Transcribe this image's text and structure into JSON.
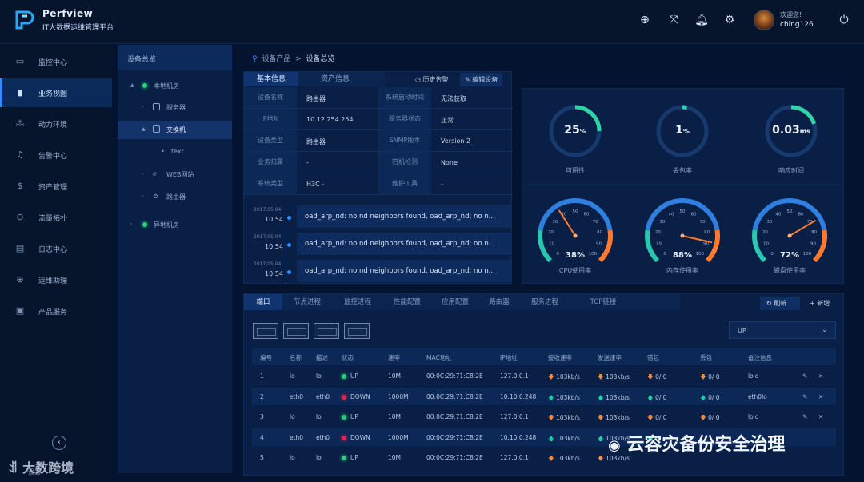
{
  "header": {
    "brand": "Perfview",
    "subtitle": "IT大数据运维管理平台",
    "welcome": "欢迎您!",
    "username": "ching126",
    "icons": [
      "add-circle-icon",
      "fullscreen-icon",
      "bell-icon",
      "settings-icon",
      "power-icon"
    ]
  },
  "sidebar": {
    "items": [
      {
        "label": "监控中心",
        "icon": "monitor-icon"
      },
      {
        "label": "业务视图",
        "icon": "bar-chart-icon",
        "active": true
      },
      {
        "label": "动力环境",
        "icon": "network-icon"
      },
      {
        "label": "告警中心",
        "icon": "bell-icon"
      },
      {
        "label": "资产管理",
        "icon": "dollar-icon"
      },
      {
        "label": "流量拓扑",
        "icon": "topology-icon"
      },
      {
        "label": "日志中心",
        "icon": "document-icon"
      },
      {
        "label": "运维助理",
        "icon": "plus-circle-icon"
      },
      {
        "label": "产品服务",
        "icon": "box-icon"
      }
    ],
    "settings": "设置"
  },
  "tree": {
    "title": "设备总览",
    "nodes": [
      {
        "label": "本地机房"
      },
      {
        "label": "服务器"
      },
      {
        "label": "交换机"
      },
      {
        "label": "text"
      },
      {
        "label": "WEB网站"
      },
      {
        "label": "路由器"
      },
      {
        "label": "异地机房"
      }
    ]
  },
  "breadcrumb": {
    "part1": "设备产品",
    "sep": ">",
    "part2": "设备总览"
  },
  "info": {
    "tab_basic": "基本信息",
    "tab_asset": "资产信息",
    "btn_history": "历史告警",
    "btn_edit": "编辑设备",
    "rows": [
      {
        "k1": "设备名称",
        "v1": "路由器",
        "k2": "系统启动时间",
        "v2": "无法获取"
      },
      {
        "k1": "IP地址",
        "v1": "10.12.254.254",
        "k2": "服务器状态",
        "v2": "正常"
      },
      {
        "k1": "设备类型",
        "v1": "路由器",
        "k2": "SNMP版本",
        "v2": "Version 2"
      },
      {
        "k1": "业务归属",
        "v1": "-",
        "k2": "宕机检测",
        "v2": "None"
      },
      {
        "k1": "系统类型",
        "v1": "H3C -",
        "k2": "维护工具",
        "v2": "-"
      }
    ],
    "logs": [
      {
        "date": "2017.05.04",
        "time": "10:54",
        "msg": "oad_arp_nd: no nd neighbors found, oad_arp_nd: no n..."
      },
      {
        "date": "2017.05.04",
        "time": "10:54",
        "msg": "oad_arp_nd: no nd neighbors found, oad_arp_nd: no n..."
      },
      {
        "date": "2017.05.04",
        "time": "10:54",
        "msg": "oad_arp_nd: no nd neighbors found, oad_arp_nd: no n..."
      }
    ]
  },
  "metrics": {
    "rings": [
      {
        "value": "25",
        "unit": "%",
        "label": "可用性",
        "fraction": 0.25
      },
      {
        "value": "1",
        "unit": "%",
        "label": "丢包率",
        "fraction": 0.03
      },
      {
        "value": "0.03",
        "unit": "ms",
        "label": "响应时间",
        "fraction": 0.2
      }
    ],
    "gauges": [
      {
        "value": "38%",
        "label": "CPU使用率",
        "fraction": 0.38
      },
      {
        "value": "88%",
        "label": "内存使用率",
        "fraction": 0.88
      },
      {
        "value": "72%",
        "label": "磁盘使用率",
        "fraction": 0.72
      }
    ],
    "gauge_ticks": [
      "0",
      "10",
      "20",
      "30",
      "40",
      "50",
      "60",
      "70",
      "80",
      "90",
      "100"
    ],
    "colors": {
      "ring": "#2fd3a7",
      "gauge_low": "#27c7b0",
      "gauge_mid": "#2f7fe0",
      "gauge_high": "#ff7a2e"
    }
  },
  "bottom": {
    "tabs": [
      "端口",
      "节点进程",
      "监控进程",
      "性能配置",
      "应用配置",
      "路由器",
      "服务进程",
      "TCP链接"
    ],
    "refresh": "刷新",
    "add": "新增",
    "filter": "UP",
    "headers": [
      "编号",
      "名称",
      "描述",
      "状态",
      "速率",
      "MAC地址",
      "IP地址",
      "接收速率",
      "发送速率",
      "错包",
      "丢包",
      "备注信息"
    ],
    "rows": [
      {
        "no": "1",
        "name": "lo",
        "desc": "lo",
        "status": "UP",
        "rate": "10M",
        "mac": "00:0C:29:71:C8:2E",
        "ip": "127.0.0.1",
        "rx": "103kb/s",
        "tx": "103kb/s",
        "err": "0/ 0",
        "drop": "0/ 0",
        "note": "lolo"
      },
      {
        "no": "2",
        "name": "eth0",
        "desc": "eth0",
        "status": "DOWN",
        "rate": "1000M",
        "mac": "00:0C:29:71:C8:2E",
        "ip": "10.10.0.248",
        "rx": "103kb/s",
        "tx": "103kb/s",
        "err": "0/ 0",
        "drop": "0/ 0",
        "note": "eth0lo"
      },
      {
        "no": "3",
        "name": "lo",
        "desc": "lo",
        "status": "UP",
        "rate": "10M",
        "mac": "00:0C:29:71:C8:2E",
        "ip": "127.0.0.1",
        "rx": "103kb/s",
        "tx": "103kb/s",
        "err": "0/ 0",
        "drop": "0/ 0",
        "note": "lolo"
      },
      {
        "no": "4",
        "name": "eth0",
        "desc": "eth0",
        "status": "DOWN",
        "rate": "1000M",
        "mac": "00:0C:29:71:C8:2E",
        "ip": "10.10.0.248",
        "rx": "103kb/s",
        "tx": "103kb/s",
        "err": "0/",
        "drop": "",
        "note": ""
      },
      {
        "no": "5",
        "name": "lo",
        "desc": "lo",
        "status": "UP",
        "rate": "10M",
        "mac": "00:0C:29:71:C8:2E",
        "ip": "127.0.0.1",
        "rx": "103kb/s",
        "tx": "103kb/s",
        "err": "",
        "drop": "",
        "note": ""
      }
    ],
    "status_colors": {
      "UP": "#25d07a",
      "DOWN": "#e0234e"
    }
  },
  "watermark": {
    "left": "大数跨境",
    "right": "云容灾备份安全治理"
  }
}
